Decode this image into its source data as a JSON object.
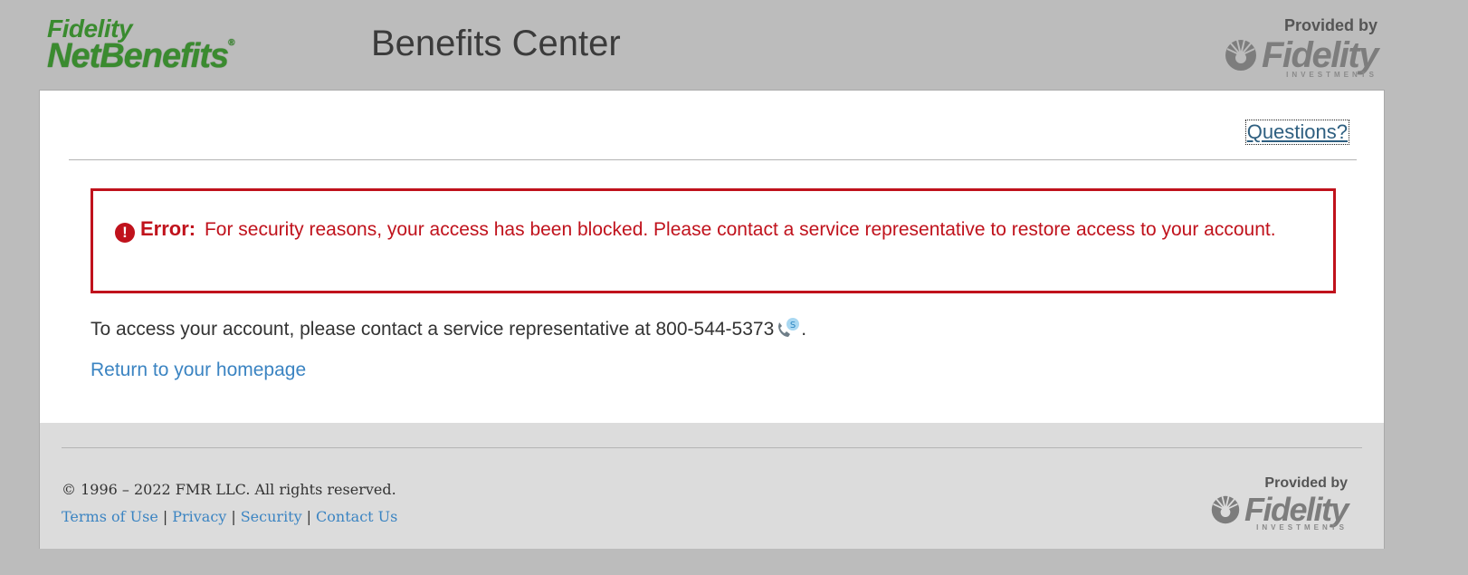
{
  "header": {
    "logo_line1": "Fidelity",
    "logo_line2": "NetBenefits",
    "logo_reg": "®",
    "title": "Benefits Center",
    "provided_label": "Provided by",
    "brand_word": "Fidelity",
    "brand_sub": "INVESTMENTS"
  },
  "card": {
    "questions_link": "Questions?",
    "error": {
      "icon": "!",
      "label": "Error:",
      "message": "For security reasons, your access has been blocked. Please contact a service representative to restore access to your account."
    },
    "contact": {
      "text": "To access your account, please contact a service representative at 800-544-5373",
      "suffix": "."
    },
    "home_link": "Return to your homepage"
  },
  "footer": {
    "copyright": "© 1996 – 2022 FMR LLC. All rights reserved.",
    "links": {
      "terms": "Terms of Use",
      "privacy": "Privacy",
      "security": "Security",
      "contact": "Contact Us"
    },
    "separator": "|",
    "provided_label": "Provided by",
    "brand_word": "Fidelity",
    "brand_sub": "INVESTMENTS"
  },
  "colors": {
    "background": "#bcbcbc",
    "error_red": "#c0121c",
    "link_blue": "#3b84c2",
    "logo_green": "#3a8b2f"
  },
  "icons": [
    "error-icon",
    "phone-icon",
    "fidelity-logo-icon"
  ]
}
